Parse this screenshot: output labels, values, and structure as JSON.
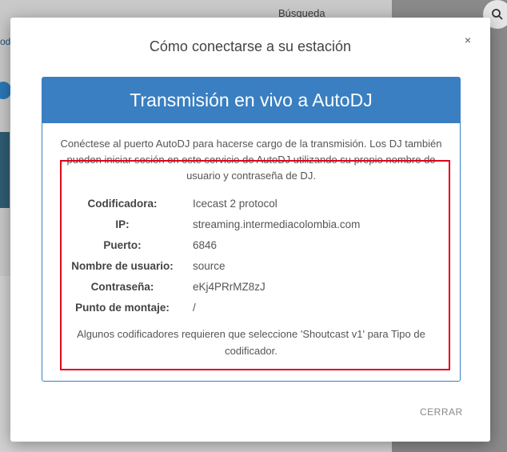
{
  "background": {
    "search_label": "Búsqueda",
    "left_text": "odi"
  },
  "modal": {
    "title": "Cómo conectarse a su estación",
    "close_glyph": "×",
    "panel_title": "Transmisión en vivo a AutoDJ",
    "intro": "Conéctese al puerto AutoDJ para hacerse cargo de la transmisión. Los DJ también pueden iniciar sesión en este servicio de AutoDJ utilizando su propio nombre de usuario y contraseña de DJ.",
    "fields": [
      {
        "label": "Codificadora:",
        "value": "Icecast 2 protocol"
      },
      {
        "label": "IP:",
        "value": "streaming.intermediacolombia.com"
      },
      {
        "label": "Puerto:",
        "value": "6846"
      },
      {
        "label": "Nombre de usuario:",
        "value": "source"
      },
      {
        "label": "Contraseña:",
        "value": "eKj4PRrMZ8zJ"
      },
      {
        "label": "Punto de montaje:",
        "value": "/"
      }
    ],
    "note": "Algunos codificadores requieren que seleccione 'Shoutcast v1' para Tipo de codificador.",
    "close_button": "CERRAR"
  },
  "colors": {
    "accent": "#3a7fc1",
    "highlight": "#e0001b"
  }
}
